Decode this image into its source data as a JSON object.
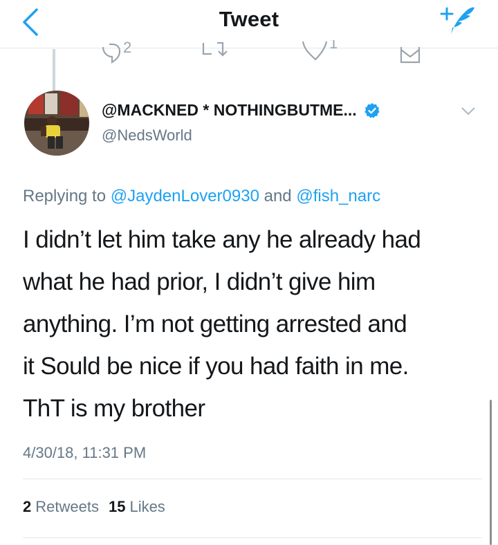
{
  "navbar": {
    "title": "Tweet",
    "back_icon": "chevron-left-icon",
    "compose_icon": "compose-tweet-icon"
  },
  "previous_tweet_actions": {
    "reply_count": "2",
    "like_count": "1"
  },
  "tweet": {
    "display_name": "@MACKNED * NOTHINGBUTME...",
    "handle": "@NedsWorld",
    "verified": true,
    "replying_prefix": "Replying to",
    "replying_mention_1": "@JaydenLover0930",
    "replying_and": "and",
    "replying_mention_2": "@fish_narc",
    "text_lines": [
      "I didn’t let him take any he already had",
      "what he had prior, I didn’t give him",
      "anything. I’m not getting arrested and",
      "it Sould be nice if you had faith in me.",
      "ThT is my brother"
    ],
    "timestamp": "4/30/18, 11:31 PM",
    "retweets_count": "2",
    "retweets_label": "Retweets",
    "likes_count": "15",
    "likes_label": "Likes"
  },
  "colors": {
    "accent": "#1da1f2",
    "secondary_text": "#657786",
    "divider": "#e1e8ed",
    "verified": "#1da1f2"
  }
}
